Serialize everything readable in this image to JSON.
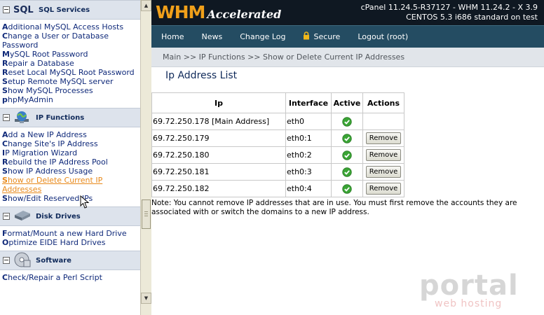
{
  "sidebar": {
    "sections": [
      {
        "title": "SQL Services",
        "icon": "sql-icon",
        "items": [
          "Additional MySQL Access Hosts",
          "Change a User or Database Password",
          "MySQL Root Password",
          "Repair a Database",
          "Reset Local MySQL Root Password",
          "Setup Remote MySQL server",
          "Show MySQL Processes",
          "phpMyAdmin"
        ]
      },
      {
        "title": "IP Functions",
        "icon": "ip-functions-icon",
        "items": [
          "Add a New IP Address",
          "Change Site's IP Address",
          "IP Migration Wizard",
          "Rebuild the IP Address Pool",
          "Show IP Address Usage",
          "Show or Delete Current IP Addresses",
          "Show/Edit Reserved IPs"
        ],
        "active": "Show or Delete Current IP Addresses"
      },
      {
        "title": "Disk Drives",
        "icon": "disk-drive-icon",
        "items": [
          "Format/Mount a new Hard Drive",
          "Optimize EIDE Hard Drives"
        ]
      },
      {
        "title": "Software",
        "icon": "software-icon",
        "items": [
          "Check/Repair a Perl Script"
        ]
      }
    ]
  },
  "header": {
    "logo_main": "WHM",
    "logo_sub": "Accelerated",
    "version_line1": "cPanel 11.24.5-R37127 - WHM 11.24.2 - X 3.9",
    "version_line2": "CENTOS 5.3 i686 standard on test"
  },
  "nav": {
    "home": "Home",
    "news": "News",
    "changelog": "Change Log",
    "secure": "Secure",
    "logout": "Logout (root)"
  },
  "breadcrumb": "Main >> IP Functions >> Show or Delete Current IP Addresses",
  "page_title": "Ip Address List",
  "table": {
    "headers": [
      "Ip",
      "Interface",
      "Active",
      "Actions"
    ],
    "rows": [
      {
        "ip": "69.72.250.178 [Main Address]",
        "interface": "eth0",
        "active": true,
        "action": ""
      },
      {
        "ip": "69.72.250.179",
        "interface": "eth0:1",
        "active": true,
        "action": "Remove"
      },
      {
        "ip": "69.72.250.180",
        "interface": "eth0:2",
        "active": true,
        "action": "Remove"
      },
      {
        "ip": "69.72.250.181",
        "interface": "eth0:3",
        "active": true,
        "action": "Remove"
      },
      {
        "ip": "69.72.250.182",
        "interface": "eth0:4",
        "active": true,
        "action": "Remove"
      }
    ]
  },
  "note": "Note: You cannot remove IP addresses that are in use. You must first remove the accounts they are associated with or switch the domains to a new IP address.",
  "watermark": {
    "main": "portal",
    "sub": "web hosting"
  },
  "colors": {
    "topbar": "#0f1822",
    "navbar": "#244c62",
    "logo_orange": "#f0a01a",
    "active_link": "#e8891a",
    "link": "#102a7a",
    "check_green": "#3aa435"
  }
}
